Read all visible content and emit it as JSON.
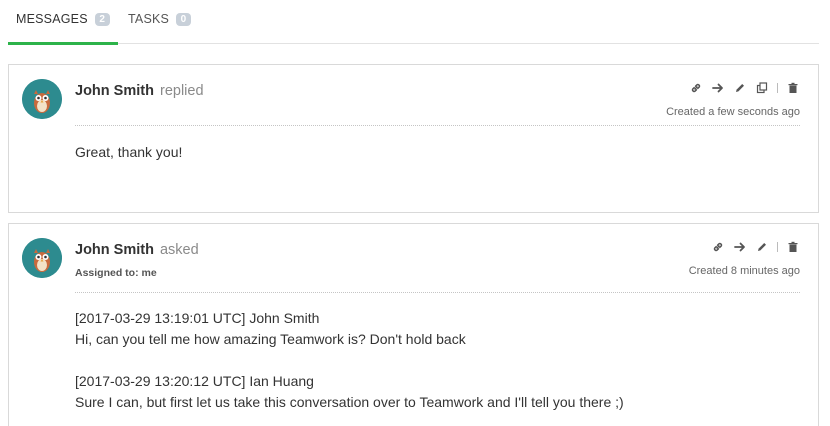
{
  "tabs": [
    {
      "label": "MESSAGES",
      "count": "2",
      "active": true
    },
    {
      "label": "TASKS",
      "count": "0",
      "active": false
    }
  ],
  "messages": [
    {
      "author": "John Smith",
      "verb": "replied",
      "created": "Created a few seconds ago",
      "lines": [
        "Great, thank you!"
      ],
      "actions": [
        "link-icon",
        "forward-arrow-icon",
        "pencil-icon",
        "copy-icon",
        "trash-icon"
      ]
    },
    {
      "author": "John Smith",
      "verb": "asked",
      "assigned": "Assigned to: me",
      "created": "Created 8 minutes ago",
      "lines": [
        "[2017-03-29 13:19:01 UTC] John Smith",
        "Hi, can you tell me how amazing Teamwork is? Don't hold back",
        "[2017-03-29 13:20:12 UTC] Ian Huang",
        "Sure I can, but first let us take this conversation over to Teamwork and I'll tell you there ;)"
      ],
      "actions": [
        "link-icon",
        "forward-arrow-icon",
        "pencil-icon",
        "trash-icon"
      ]
    }
  ],
  "colors": {
    "accent": "#2db34a",
    "avatar_bg": "#2d8b8f",
    "badge": "#c8d0d9"
  }
}
